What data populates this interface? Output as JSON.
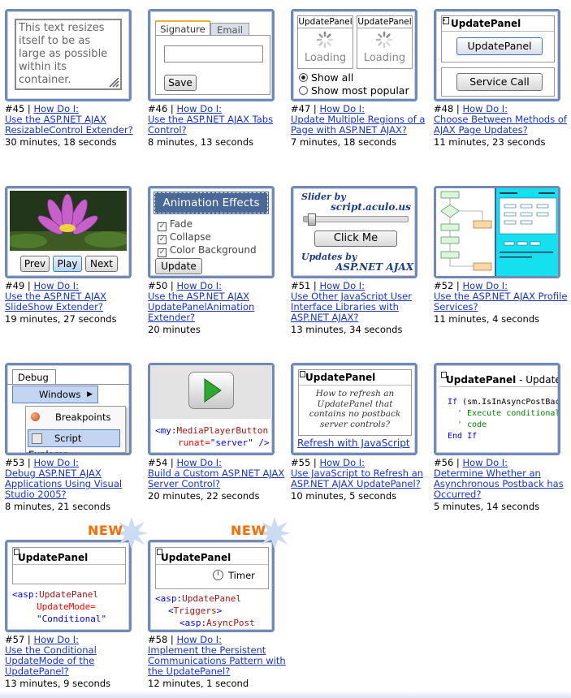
{
  "how_do_i": "How Do I:",
  "cards": [
    {
      "num": "#45 | ",
      "title": "Use the ASP.NET AJAX ResizableControl Extender?",
      "duration": "30 minutes, 18 seconds",
      "thumb": {
        "text": "This text resizes itself to be as large as possible within its container."
      }
    },
    {
      "num": "#46 | ",
      "title": "Use the ASP.NET AJAX Tabs Control?",
      "duration": "8 minutes, 13 seconds",
      "thumb": {
        "tab1": "Signature",
        "tab2": "Email",
        "save": "Save"
      }
    },
    {
      "num": "#47 | ",
      "title": "Update Multiple Regions of a Page with ASP.NET AJAX?",
      "duration": "7 minutes, 18 seconds",
      "thumb": {
        "panel1": "UpdatePanel",
        "panel2": "UpdatePanel",
        "loading": "Loading",
        "radio1": "Show all",
        "radio2": "Show most popular"
      }
    },
    {
      "num": "#48 | ",
      "title": "Choose Between Methods of AJAX Page Updates?",
      "duration": "11 minutes, 23 seconds",
      "thumb": {
        "header": "UpdatePanel",
        "btn1": "UpdatePanel",
        "btn2": "Service Call"
      }
    },
    {
      "num": "#49 | ",
      "title": "Use the ASP.NET AJAX SlideShow Extender?",
      "duration": "19 minutes, 27 seconds",
      "thumb": {
        "prev": "Prev",
        "play": "Play",
        "next": "Next"
      }
    },
    {
      "num": "#50 | ",
      "title": "Use the ASP.NET AJAX UpdatePanelAnimation Extender?",
      "duration": "20 minutes",
      "thumb": {
        "header": "Animation Effects",
        "opt1": "Fade",
        "opt2": "Collapse",
        "opt3": "Color Background",
        "update": "Update"
      }
    },
    {
      "num": "#51 | ",
      "title": "Use Other JavaScript User Interface Libraries with ASP.NET AJAX?",
      "duration": "13 minutes, 34 seconds",
      "thumb": {
        "line1": "Slider by",
        "line2": "script.aculo.us",
        "click": "Click Me",
        "line3": "Updates by",
        "line4": "ASP.NET AJAX",
        "slider_value": 0.05
      }
    },
    {
      "num": "#52 | ",
      "title": "Use the ASP.NET AJAX Profile Services?",
      "duration": "11 minutes, 4 seconds",
      "thumb": {}
    },
    {
      "num": "#53 | ",
      "title": "Debug ASP.NET AJAX Applications Using Visual Studio 2005?",
      "duration": "8 minutes, 21 seconds",
      "thumb": {
        "menu": "Debug",
        "windows": "Windows",
        "item1": "Breakpoints",
        "item2": "Script Explorer"
      }
    },
    {
      "num": "#54 | ",
      "title": "Build a Custom ASP.NET AJAX Server Control?",
      "duration": "20 minutes, 22 seconds",
      "thumb": {
        "code1a": "<my:",
        "code1b": "MediaPlayerButton",
        "code2a": "runat=",
        "code2b": "\"server\"",
        "code2c": " />"
      }
    },
    {
      "num": "#55 | ",
      "title": "Use JavaScript to Refresh an ASP.NET AJAX UpdatePanel?",
      "duration": "10 minutes, 5 seconds",
      "thumb": {
        "header": "UpdatePanel",
        "body": "How to refresh an UpdatePanel that contains no postback server controls?",
        "link": "Refresh with JavaScript"
      }
    },
    {
      "num": "#56 | ",
      "title": "Determine Whether an Asynchronous Postback has Occurred?",
      "duration": "5 minutes, 14 seconds",
      "thumb": {
        "header": "UpdatePanel",
        "header_suffix": " - UpdatePane",
        "l1a": "If",
        "l1b": " (sm.IsInAsyncPostBack)",
        "l2": "' Execute conditional",
        "l3": "' code",
        "l4": "End If"
      }
    },
    {
      "num": "#57 | ",
      "title": "Use the Conditional UpdateMode of the UpdatePanel?",
      "duration": "13 minutes, 9 seconds",
      "thumb": {
        "badge": "NEW",
        "header": "UpdatePanel",
        "c1a": "<asp:",
        "c1b": "UpdatePanel",
        "c2": "UpdateMode=",
        "c3": "\"Conditional\""
      }
    },
    {
      "num": "#58 | ",
      "title": "Implement the Persistent Communications Pattern with the UpdatePanel?",
      "duration": "12 minutes, 1 second",
      "thumb": {
        "badge": "NEW",
        "header": "UpdatePanel",
        "timer": "Timer",
        "c1a": "<asp:",
        "c1b": "UpdatePanel",
        "c2a": "<",
        "c2b": "Triggers",
        "c2c": ">",
        "c3a": "<asp:",
        "c3b": "AsyncPost"
      }
    }
  ],
  "colors": {
    "link": "#1a33c8",
    "border": "#7189b5",
    "new": "#ff6a00",
    "code_blue": "#0000ff",
    "code_maroon": "#a31515",
    "code_red": "#ff0000",
    "code_green": "#008000",
    "profile_cyan": "#14e0ee"
  }
}
